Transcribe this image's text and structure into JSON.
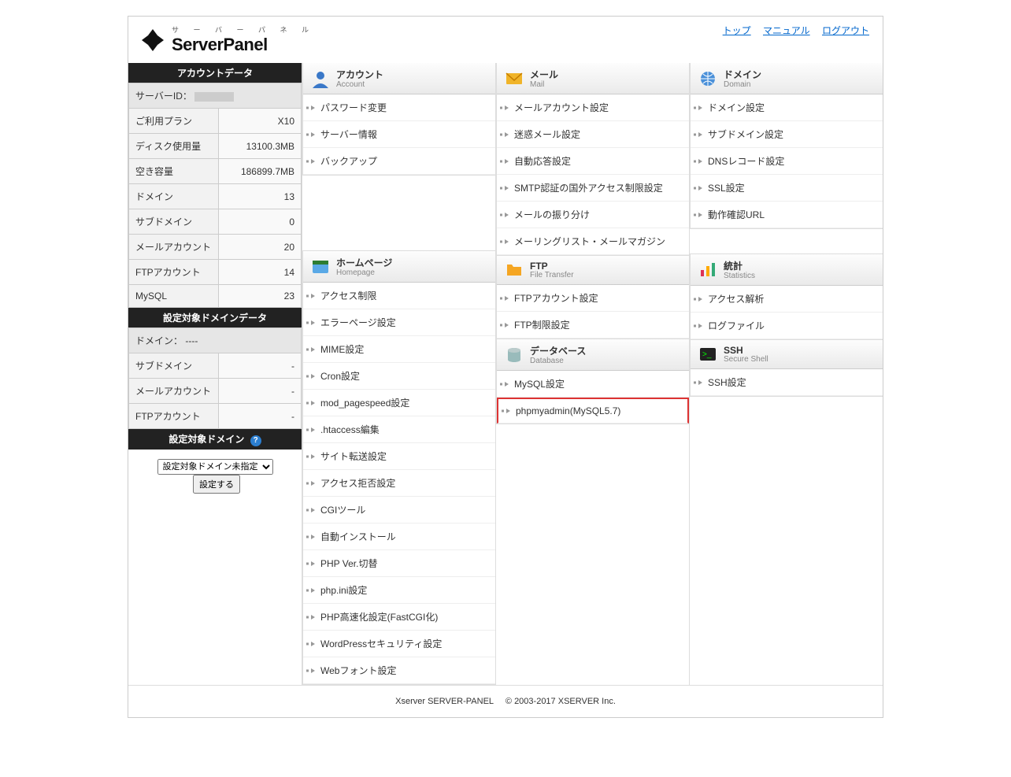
{
  "header": {
    "kana": "サ ー バ ー パ ネ ル",
    "title": "ServerPanel",
    "links": {
      "top": "トップ",
      "manual": "マニュアル",
      "logout": "ログアウト"
    }
  },
  "sidebar": {
    "account_title": "アカウントデータ",
    "rows": [
      {
        "label": "サーバーID：",
        "value": ""
      },
      {
        "label": "ご利用プラン",
        "value": "X10"
      },
      {
        "label": "ディスク使用量",
        "value": "13100.3MB"
      },
      {
        "label": "空き容量",
        "value": "186899.7MB"
      },
      {
        "label": "ドメイン",
        "value": "13"
      },
      {
        "label": "サブドメイン",
        "value": "0"
      },
      {
        "label": "メールアカウント",
        "value": "20"
      },
      {
        "label": "FTPアカウント",
        "value": "14"
      },
      {
        "label": "MySQL",
        "value": "23"
      }
    ],
    "domain_data_title": "設定対象ドメインデータ",
    "domain_rows": [
      {
        "label": "ドメイン：",
        "value": "----"
      },
      {
        "label": "サブドメイン",
        "value": "-"
      },
      {
        "label": "メールアカウント",
        "value": "-"
      },
      {
        "label": "FTPアカウント",
        "value": "-"
      }
    ],
    "target_domain_title": "設定対象ドメイン",
    "select_placeholder": "設定対象ドメイン未指定",
    "set_button": "設定する"
  },
  "cards": {
    "account": {
      "title": "アカウント",
      "subtitle": "Account",
      "items": [
        "パスワード変更",
        "サーバー情報",
        "バックアップ"
      ]
    },
    "mail": {
      "title": "メール",
      "subtitle": "Mail",
      "items": [
        "メールアカウント設定",
        "迷惑メール設定",
        "自動応答設定",
        "SMTP認証の国外アクセス制限設定",
        "メールの振り分け",
        "メーリングリスト・メールマガジン"
      ]
    },
    "domain": {
      "title": "ドメイン",
      "subtitle": "Domain",
      "items": [
        "ドメイン設定",
        "サブドメイン設定",
        "DNSレコード設定",
        "SSL設定",
        "動作確認URL"
      ]
    },
    "homepage": {
      "title": "ホームページ",
      "subtitle": "Homepage",
      "items": [
        "アクセス制限",
        "エラーページ設定",
        "MIME設定",
        "Cron設定",
        "mod_pagespeed設定",
        ".htaccess編集",
        "サイト転送設定",
        "アクセス拒否設定",
        "CGIツール",
        "自動インストール",
        "PHP Ver.切替",
        "php.ini設定",
        "PHP高速化設定(FastCGI化)",
        "WordPressセキュリティ設定",
        "Webフォント設定"
      ]
    },
    "ftp": {
      "title": "FTP",
      "subtitle": "File Transfer",
      "items": [
        "FTPアカウント設定",
        "FTP制限設定"
      ]
    },
    "database": {
      "title": "データベース",
      "subtitle": "Database",
      "items": [
        "MySQL設定",
        "phpmyadmin(MySQL5.7)"
      ]
    },
    "stats": {
      "title": "統計",
      "subtitle": "Statistics",
      "items": [
        "アクセス解析",
        "ログファイル"
      ]
    },
    "ssh": {
      "title": "SSH",
      "subtitle": "Secure Shell",
      "items": [
        "SSH設定"
      ]
    }
  },
  "footer": {
    "left": "Xserver SERVER-PANEL",
    "right": "© 2003-2017 XSERVER Inc."
  }
}
